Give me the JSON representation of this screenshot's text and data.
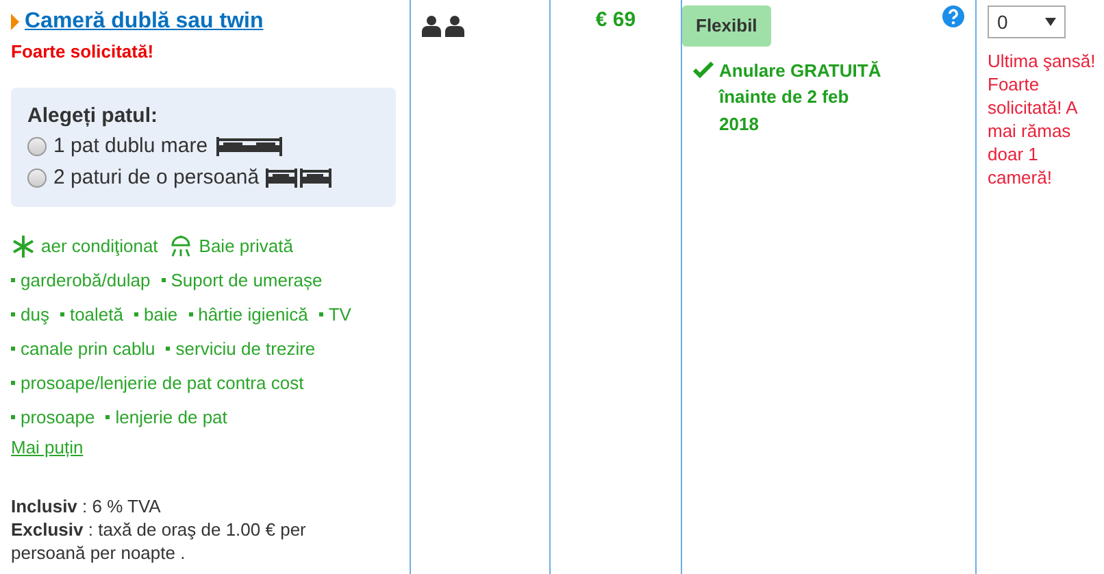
{
  "room": {
    "title": "Cameră dublă sau twin",
    "demand": "Foarte solicitată!",
    "bed_choice": {
      "heading": "Alegeți patul:",
      "options": [
        {
          "label": "1 pat dublu mare",
          "selected": false
        },
        {
          "label": "2 paturi de o persoană",
          "selected": false
        }
      ]
    },
    "facility_lines": [
      [
        {
          "kind": "featured",
          "label": "aer condiţionat"
        },
        {
          "kind": "featured",
          "label": "Baie privată"
        }
      ],
      [
        {
          "kind": "bullet",
          "label": "garderobă/dulap"
        },
        {
          "kind": "bullet",
          "label": "Suport de umerașe"
        }
      ],
      [
        {
          "kind": "bullet",
          "label": "duş"
        },
        {
          "kind": "bullet",
          "label": "toaletă"
        },
        {
          "kind": "bullet",
          "label": "baie"
        },
        {
          "kind": "bullet",
          "label": "hârtie igienică"
        },
        {
          "kind": "bullet",
          "label": "TV"
        }
      ],
      [
        {
          "kind": "bullet",
          "label": "canale prin cablu"
        },
        {
          "kind": "bullet",
          "label": "serviciu de trezire"
        }
      ],
      [
        {
          "kind": "bullet",
          "label": "prosoape/lenjerie de pat contra cost"
        }
      ],
      [
        {
          "kind": "bullet",
          "label": "prosoape"
        },
        {
          "kind": "bullet",
          "label": "lenjerie de pat"
        }
      ]
    ],
    "less_link": "Mai puțin",
    "taxes": [
      "**Inclusiv** : 6 % TVA",
      "**Exclusiv** : taxă de oraş de 1.00 € per persoană per noapte ."
    ]
  },
  "price": "€ 69",
  "policy": {
    "badge": "Flexibil",
    "cancellation": "Anulare GRATUITĂ înainte de 2 feb 2018"
  },
  "quantity": {
    "value": "0",
    "warning": "Ultima şansă! Foarte solicitată! A mai rămas doar 1 cameră!"
  }
}
